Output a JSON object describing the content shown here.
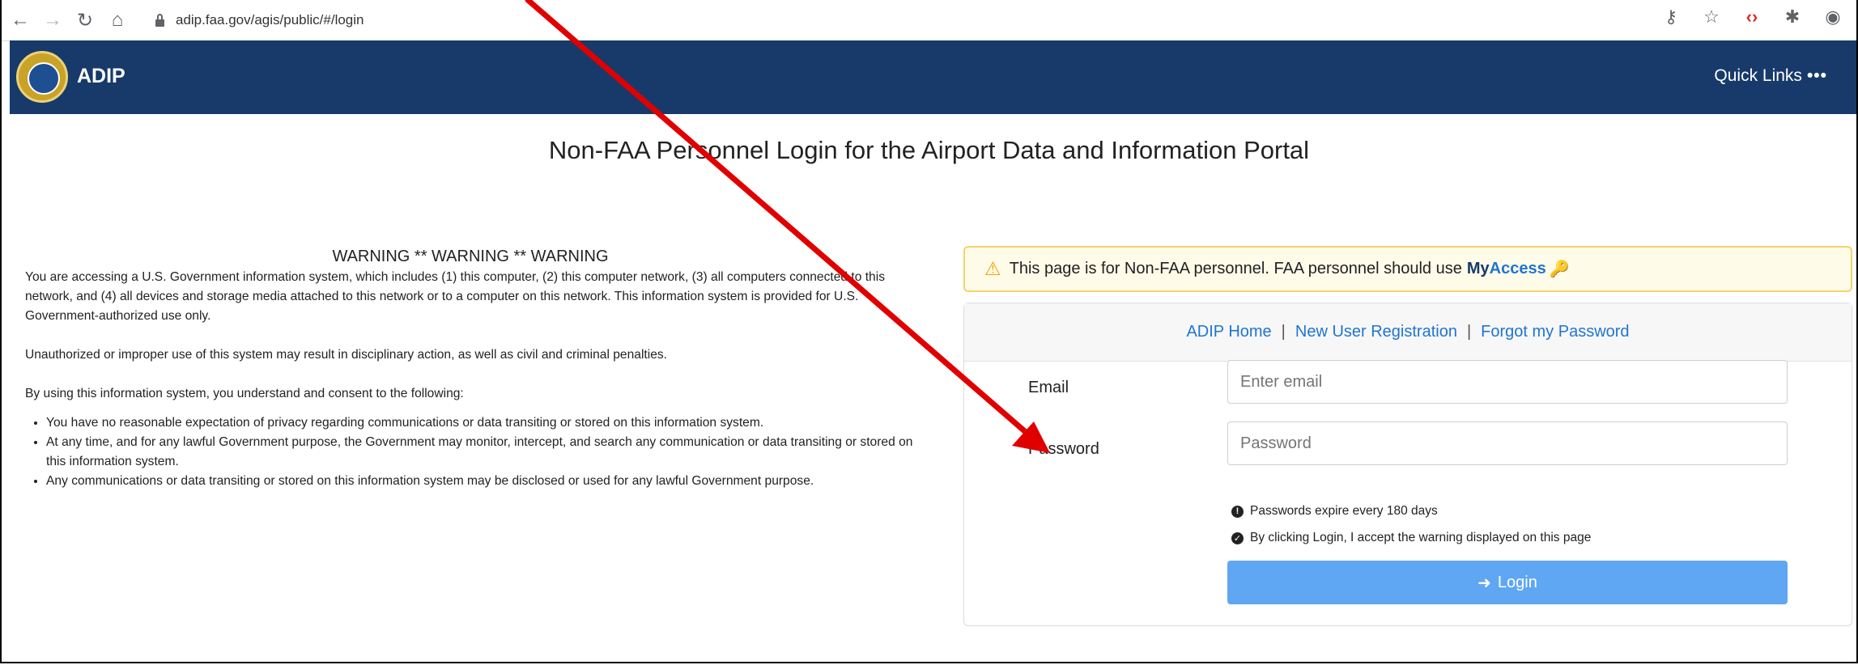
{
  "browser": {
    "url": "adip.faa.gov/agis/public/#/login",
    "icons": [
      "back-icon",
      "forward-icon",
      "reload-icon",
      "home-icon",
      "lock-icon",
      "key-icon",
      "star-icon",
      "code-icon",
      "extension-icon",
      "account-icon"
    ]
  },
  "header": {
    "brand": "ADIP",
    "quick_links": "Quick Links",
    "quick_links_dots": "•••",
    "bg_color": "#173a6b"
  },
  "page": {
    "title": "Non-FAA Personnel Login for the Airport Data and Information Portal"
  },
  "warning": {
    "heading": "WARNING ** WARNING ** WARNING",
    "p1": "You are accessing a U.S. Government information system, which includes (1) this computer, (2) this computer network, (3) all computers connected to this network, and (4) all devices and storage media attached to this network or to a computer on this network. This information system is provided for U.S. Government-authorized use only.",
    "p2": "Unauthorized or improper use of this system may result in disciplinary action, as well as civil and criminal penalties.",
    "p3": "By using this information system, you understand and consent to the following:",
    "bullets": [
      "You have no reasonable expectation of privacy regarding communications or data transiting or stored on this information system.",
      "At any time, and for any lawful Government purpose, the Government may monitor, intercept, and search any communication or data transiting or stored on this information system.",
      "Any communications or data transiting or stored on this information system may be disclosed or used for any lawful Government purpose."
    ]
  },
  "alert": {
    "text": "This page is for Non-FAA personnel. FAA personnel should use",
    "my": "My",
    "access": "Access"
  },
  "panel": {
    "links": [
      "ADIP Home",
      "New User Registration",
      "Forgot my Password"
    ],
    "separator": "|",
    "email_label": "Email",
    "email_placeholder": "Enter email",
    "password_label": "Password",
    "password_placeholder": "Password",
    "note_expire": "Passwords expire every 180 days",
    "note_accept": "By clicking Login, I accept the warning displayed on this page",
    "login_label": "Login"
  },
  "colors": {
    "link": "#1f75d1",
    "button": "#5fa7f2",
    "annotation_arrow": "#e00000"
  }
}
